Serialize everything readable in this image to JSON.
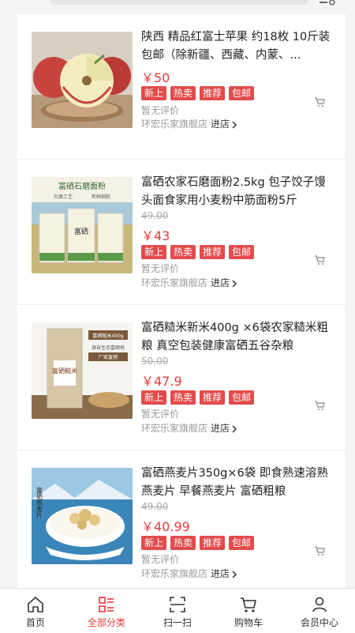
{
  "products": [
    {
      "title": "陕西 精品红富士苹果 约18枚 10斤装 包邮（除新疆、西藏、内蒙、...",
      "old_price": "",
      "price": "￥50",
      "tags": [
        "新上",
        "热卖",
        "推荐",
        "包邮"
      ],
      "review": "暂无评价",
      "store": "环宏乐家旗舰店",
      "go": "进店"
    },
    {
      "title": "富硒农家石磨面粉2.5kg 包子饺子馒头面食家用小麦粉中筋面粉5斤",
      "old_price": "49.00",
      "price": "￥43",
      "tags": [
        "新上",
        "热卖",
        "推荐",
        "包邮"
      ],
      "review": "暂无评价",
      "store": "环宏乐家旗舰店",
      "go": "进店",
      "image_text": [
        "富硒石磨面粉",
        "石磨工艺",
        "新鲜细腻",
        "富硒"
      ]
    },
    {
      "title": "富硒糙米新米400g ×6袋农家糙米粗粮 真空包装健康富硒五谷杂粮",
      "old_price": "50.00",
      "price": "￥47.9",
      "tags": [
        "新上",
        "热卖",
        "推荐",
        "包邮"
      ],
      "review": "暂无评价",
      "store": "环宏乐家旗舰店",
      "go": "进店",
      "image_text": [
        "富硒糙米400g",
        "源自生态富硒地",
        "厂家直销",
        "富硒糙米"
      ]
    },
    {
      "title": "富硒燕麦片350g×6袋 即食熟速溶熟燕麦片 早餐燕麦片 富硒粗粮",
      "old_price": "49.00",
      "price": "￥40.99",
      "tags": [
        "新上",
        "热卖",
        "推荐",
        "包邮"
      ],
      "review": "暂无评价",
      "store": "环宏乐家旗舰店",
      "go": "进店",
      "image_text": [
        "富硒燕麦片"
      ]
    }
  ],
  "tabbar": [
    {
      "label": "首页",
      "icon": "home-icon",
      "active": false
    },
    {
      "label": "全部分类",
      "icon": "category-icon",
      "active": true
    },
    {
      "label": "扫一扫",
      "icon": "scan-icon",
      "active": false
    },
    {
      "label": "购物车",
      "icon": "cart-icon",
      "active": false
    },
    {
      "label": "会员中心",
      "icon": "member-icon",
      "active": false
    }
  ],
  "colors": {
    "accent": "#e53b3b",
    "tag": "#e24c4c"
  }
}
